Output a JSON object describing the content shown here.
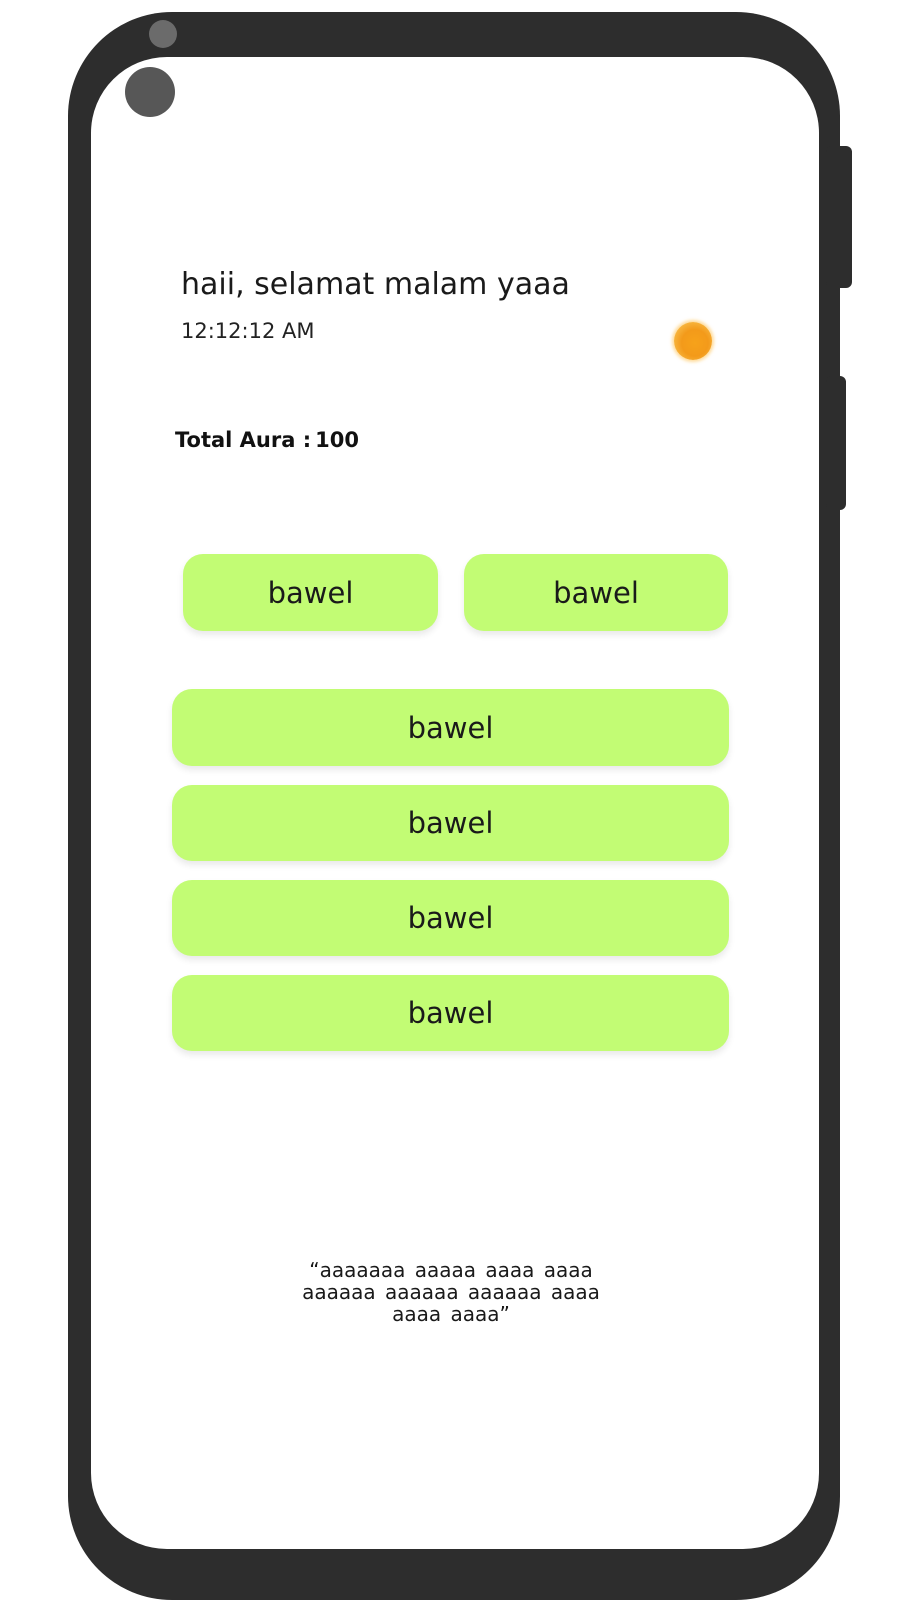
{
  "header": {
    "greeting": "haii, selamat malam yaaa",
    "time": "12:12:12 AM",
    "weather_icon": "sun-icon"
  },
  "aura": {
    "label": "Total Aura :",
    "value": "100"
  },
  "buttons": {
    "row": [
      "bawel",
      "bawel"
    ],
    "list": [
      "bawel",
      "bawel",
      "bawel",
      "bawel"
    ]
  },
  "quote": {
    "text": "“aaaaaaa   aaaaa  aaaa  aaaa aaaaaa   aaaaaa aaaaaa aaaa aaaa aaaa”"
  },
  "colors": {
    "button_bg": "#c2fc74",
    "frame": "#2d2d2d",
    "sun": "#f39a1a"
  }
}
